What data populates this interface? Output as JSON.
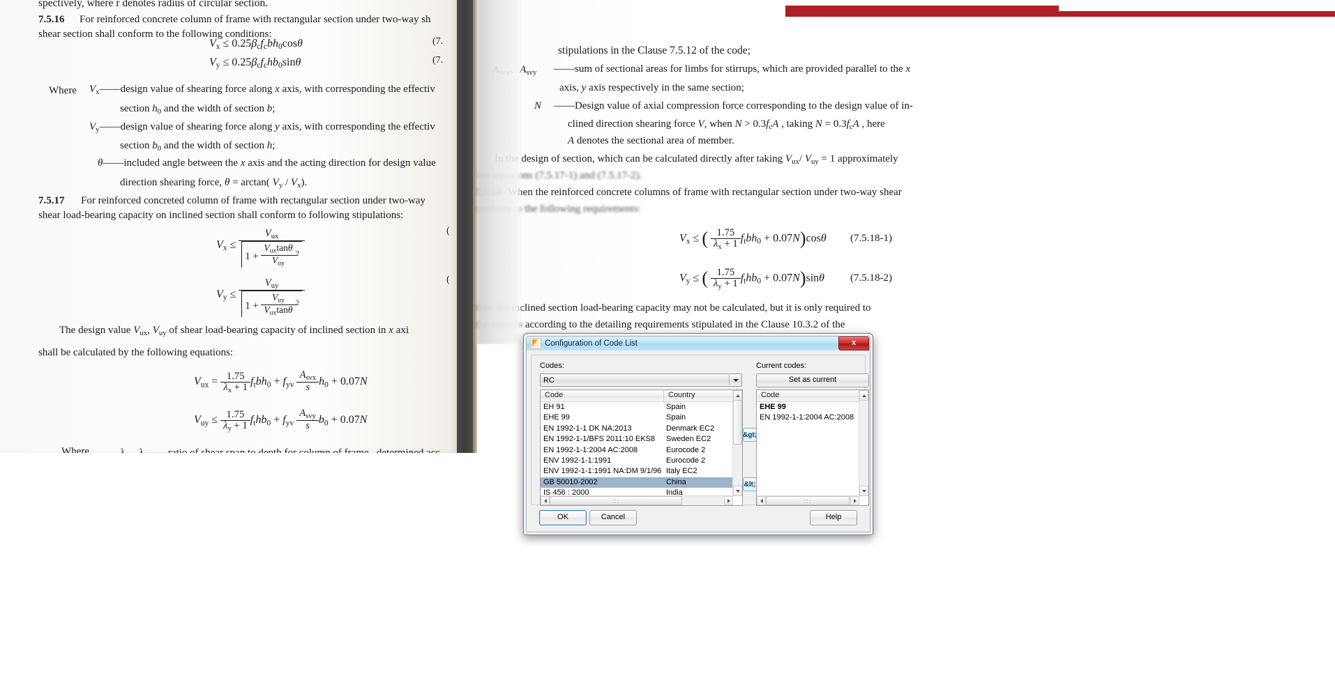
{
  "document": {
    "left_page": {
      "line_top": "spectively, where r denotes radius of circular section.",
      "clause_7516_num": "7.5.16",
      "clause_7516_text": "For reinforced concrete column of frame with rectangular section under two-way shear, shear section shall conform to the following conditions:",
      "eq_7516_1": "Vx ≤ 0.25βcfcbh0cosθ",
      "eq_7516_2": "Vy ≤ 0.25βcfchb0sinθ",
      "eq_7516_1_num": "(7.",
      "eq_7516_2_num": "(7.",
      "where_label": "Where",
      "def_vx": "Vx——design value of shearing force along x axis, with corresponding the effective",
      "def_vx_2": "section h0 and the width of section b;",
      "def_vy": "Vy——design value of shearing force along y axis, with corresponding the effective",
      "def_vy_2": "section b0 and the width of section h;",
      "def_theta": "θ——included angle between the x axis and the acting direction for design value",
      "def_theta_2": "direction shearing force, θ = arctan( Vy / Vx).",
      "clause_7517_num": "7.5.17",
      "clause_7517_text": "For reinforced concreted column of frame with rectangular section under two-way",
      "clause_7517_text2": "shear load-bearing capacity on inclined section shall conform to following stipulations:",
      "design_value_text": "The design value Vux, Vuy of shear load-bearing capacity of inclined section in x axi",
      "design_value_text2": "shall be calculated by the following equations:",
      "where_label2": "Where",
      "lambda_def": "λx、λy——ratio of shear span to depth for column of frame , determined acc"
    },
    "right_page": {
      "line1": "stipulations in the Clause 7.5.12 of the code;",
      "asvx_label": "Asvx、Asvy",
      "asvx_def": "——sum of sectional areas for limbs for stirrups, which are provided parallel to the x",
      "asvx_def2": "axis, y axis respectively in the same section;",
      "n_label": "N",
      "n_def": "——Design value of axial compression force corresponding to the design value of in-",
      "n_def2": "clined direction shearing force V, when N > 0.3fcA, taking N = 0.3fcA, here",
      "n_def3": "A denotes the sectional area of member.",
      "design_para": "In the design of section, which can be calculated directly after taking Vux/Vuy = 1 approximately",
      "design_para2": "the equations (7.5.17-1) and (7.5.17-2).",
      "clause_7518_num": "7.5.18",
      "clause_7518_text": "When the reinforced concrete columns of frame with rectangular section under two-way shear",
      "clause_7518_text2": "conform to the following requirements:",
      "eq_7518_1_num": "(7.5.18-1)",
      "eq_7518_2_num": "(7.5.18-2)",
      "tail1": "then the inclined section load-bearing capacity may not be calculated, but it is only required to",
      "tail2": "the stirrups according to the detailing requirements stipulated in the Clause 10.3.2 of the"
    },
    "banner_color": "#b01e26"
  },
  "dialog": {
    "title": "Configuration of Code List",
    "close_label": "x",
    "codes_label": "Codes:",
    "current_codes_label": "Current codes:",
    "combo_value": "RC",
    "set_as_current_label": "Set as current",
    "left_list": {
      "headers": [
        "Code",
        "Country"
      ],
      "rows": [
        {
          "code": "EH 91",
          "country": "Spain",
          "selected": false
        },
        {
          "code": "EHE 99",
          "country": "Spain",
          "selected": false
        },
        {
          "code": "EN 1992-1-1 DK NA:2013",
          "country": "Denmark EC2",
          "selected": false
        },
        {
          "code": "EN 1992-1-1/BFS 2011:10 EKS8",
          "country": "Sweden EC2",
          "selected": false
        },
        {
          "code": "EN 1992-1-1:2004 AC:2008",
          "country": "Eurocode 2",
          "selected": false
        },
        {
          "code": "ENV 1992-1-1:1991",
          "country": "Eurocode 2",
          "selected": false
        },
        {
          "code": "ENV 1992-1-1:1991 NA:DM 9/1/96",
          "country": "Italy EC2",
          "selected": false
        },
        {
          "code": "GB 50010-2002",
          "country": "China",
          "selected": true
        },
        {
          "code": "IS 456 : 2000",
          "country": "India",
          "selected": false
        }
      ]
    },
    "right_list": {
      "headers": [
        "Code"
      ],
      "rows": [
        {
          "code": "EHE 99",
          "bold": true
        },
        {
          "code": "EN 1992-1-1:2004 AC:2008",
          "bold": false
        }
      ]
    },
    "add_button_label": "&gt;",
    "remove_button_label": "&lt;",
    "ok_label": "OK",
    "cancel_label": "Cancel",
    "help_label": "Help",
    "hscroll_glyph": ":::",
    "accent_color": "#9cb4cc",
    "title_color": "#a8d8f4"
  }
}
